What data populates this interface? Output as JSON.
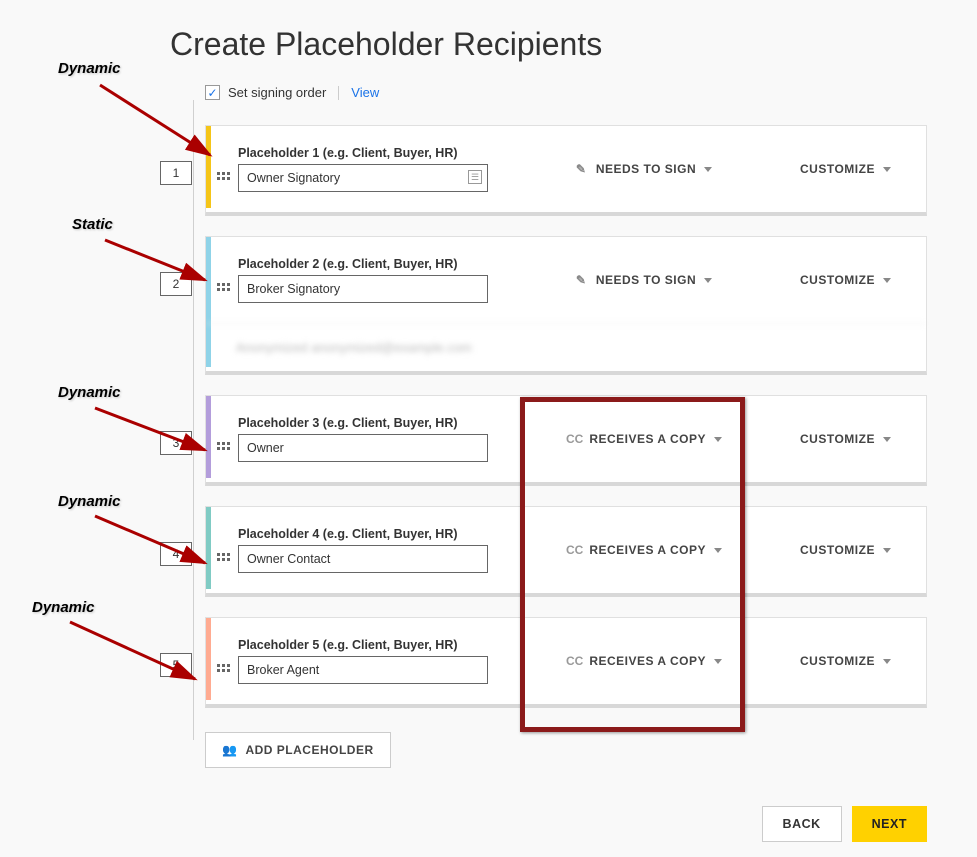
{
  "title": "Create Placeholder Recipients",
  "signing_order": {
    "checked": true,
    "label": "Set signing order",
    "view_link": "View"
  },
  "placeholder_hint_prefix": "Placeholder",
  "placeholder_hint_suffix": " (e.g. Client, Buyer, HR)",
  "actions": {
    "needs_to_sign": "NEEDS TO SIGN",
    "receives_a_copy": "RECEIVES A COPY",
    "customize": "CUSTOMIZE",
    "cc": "CC"
  },
  "add_placeholder_label": "ADD PLACEHOLDER",
  "buttons": {
    "back": "BACK",
    "next": "NEXT"
  },
  "recipients": [
    {
      "order": "1",
      "label_n": "1",
      "value": "Owner Signatory",
      "action": "needs_to_sign",
      "accent": "acc-yellow",
      "has_contact_icon": true
    },
    {
      "order": "2",
      "label_n": "2",
      "value": "Broker Signatory",
      "action": "needs_to_sign",
      "accent": "acc-blue",
      "sub_blurred": "Anonymized anonymized@example.com"
    },
    {
      "order": "3",
      "label_n": "3",
      "value": "Owner",
      "action": "receives_a_copy",
      "accent": "acc-purple"
    },
    {
      "order": "4",
      "label_n": "4",
      "value": "Owner Contact",
      "action": "receives_a_copy",
      "accent": "acc-teal"
    },
    {
      "order": "5",
      "label_n": "5",
      "value": "Broker Agent",
      "action": "receives_a_copy",
      "accent": "acc-orange"
    }
  ],
  "annotations": {
    "dynamic": "Dynamic",
    "static": "Static"
  }
}
